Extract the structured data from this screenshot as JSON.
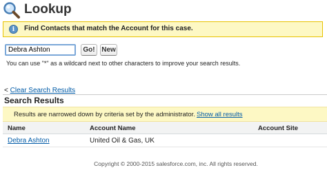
{
  "header": {
    "title": "Lookup",
    "icon": "magnifier-icon"
  },
  "info_banner": {
    "icon": "info-icon",
    "icon_glyph": "i",
    "text": "Find Contacts that match the Account for this case."
  },
  "search": {
    "value": "Debra Ashton",
    "go_label": "Go!",
    "new_label": "New",
    "hint": "You can use \"*\" as a wildcard next to other characters to improve your search results."
  },
  "results": {
    "clear_prefix": "<",
    "clear_link": "Clear Search Results",
    "title": "Search Results",
    "notice_text": "Results are narrowed down by criteria set by the administrator.",
    "notice_link": "Show all results",
    "columns": [
      "Name",
      "Account Name",
      "Account Site"
    ],
    "rows": [
      {
        "name": "Debra Ashton",
        "account_name": "United Oil & Gas, UK",
        "account_site": ""
      }
    ]
  },
  "footer": {
    "copyright": "Copyright © 2000-2015 salesforce.com, inc. All rights reserved."
  },
  "colors": {
    "link": "#015ba7",
    "banner_bg": "#fdf8c4",
    "banner_border": "#e8c200",
    "input_focus": "#7aa7d8"
  }
}
